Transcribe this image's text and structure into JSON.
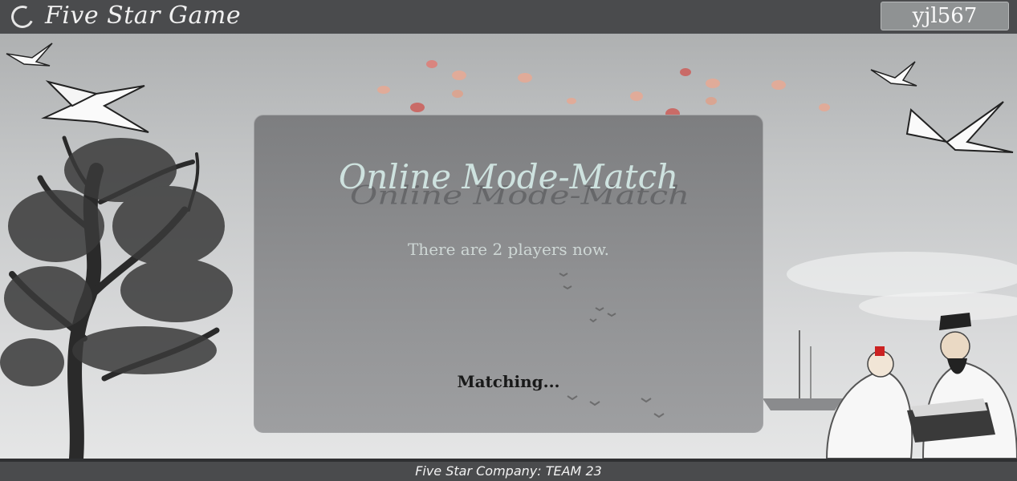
{
  "header": {
    "app_title": "Five Star Game",
    "username": "yjl567"
  },
  "panel": {
    "title": "Online Mode-Match",
    "players_status": "There are 2 players now.",
    "matching_status": "Matching..."
  },
  "footer": {
    "text": "Five Star Company: TEAM 23"
  }
}
